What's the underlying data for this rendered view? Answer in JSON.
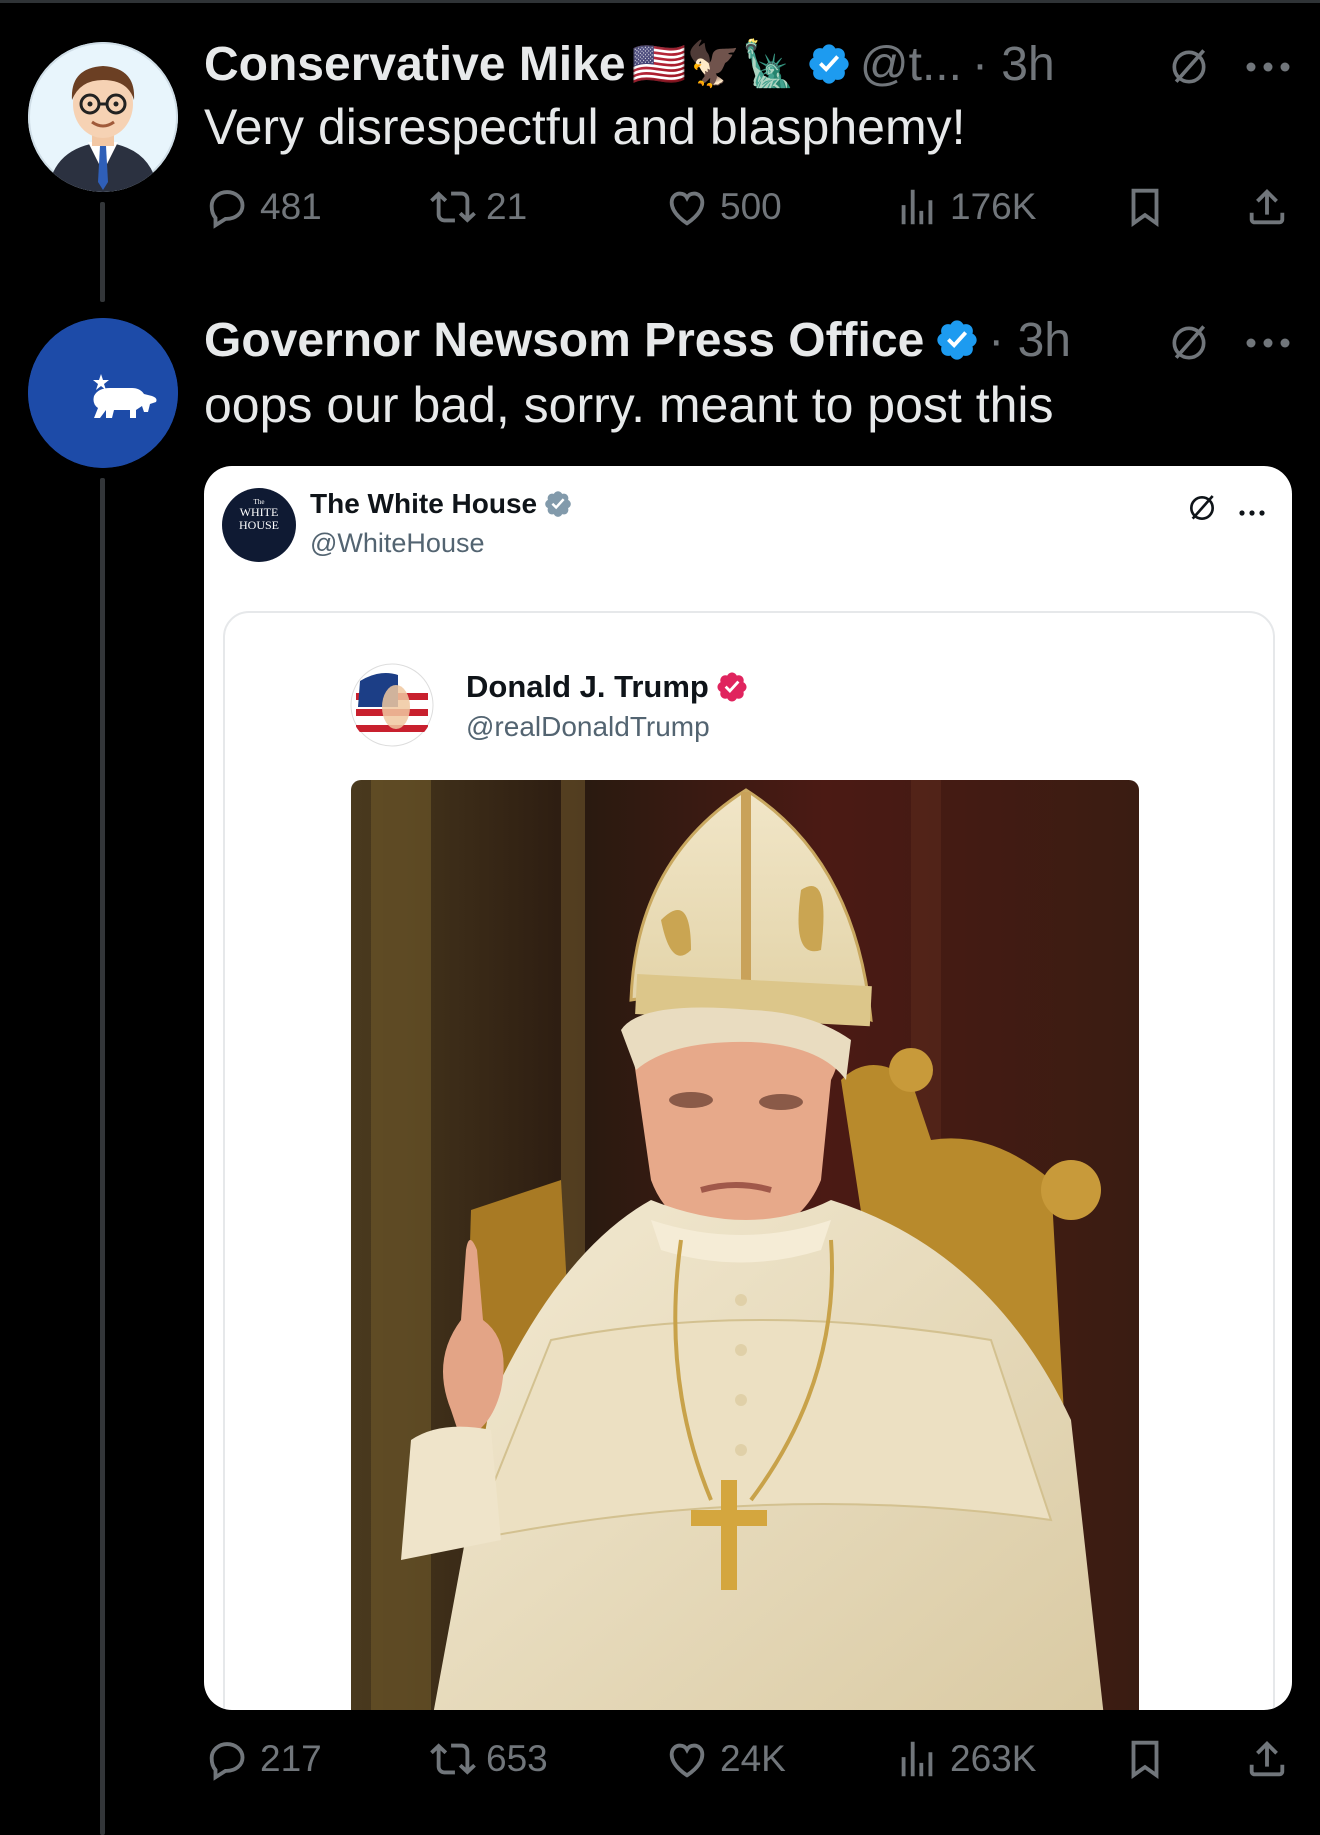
{
  "tweets": [
    {
      "name": "Conservative Mike",
      "name_emoji": "🇺🇸🦅🗽",
      "handle": "@t...",
      "time": "· 3h",
      "text": "Very disrespectful and blasphemy!",
      "stats": {
        "replies": "481",
        "reposts": "21",
        "likes": "500",
        "views": "176K"
      }
    },
    {
      "name": "Governor Newsom Press Office",
      "time": "· 3h",
      "text": "oops our bad, sorry. meant to post this",
      "stats": {
        "replies": "217",
        "reposts": "653",
        "likes": "24K",
        "views": "263K"
      }
    }
  ],
  "embed": {
    "outer": {
      "name": "The White House",
      "handle": "@WhiteHouse",
      "avatar_text_small": "The",
      "avatar_text_1": "WHITE",
      "avatar_text_2": "HOUSE"
    },
    "inner": {
      "name": "Donald J. Trump",
      "handle": "@realDonaldTrump"
    }
  },
  "colors": {
    "background": "#000000",
    "muted": "#71767b",
    "text": "#e7e9ea",
    "verified_blue": "#1d9bf0",
    "verified_red": "#e0245e",
    "newsom_blue": "#1d4ba8"
  },
  "icons": [
    "reply-icon",
    "repost-icon",
    "like-icon",
    "views-icon",
    "bookmark-icon",
    "share-icon",
    "grok-icon",
    "more-icon",
    "verified-icon",
    "bear-icon"
  ]
}
